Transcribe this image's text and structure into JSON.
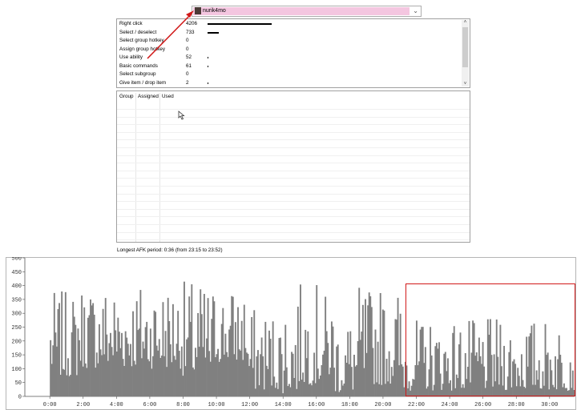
{
  "player": {
    "name": "nurik4mo"
  },
  "actions": [
    {
      "label": "Right click",
      "count": "4206",
      "value": 4206
    },
    {
      "label": "Select / deselect",
      "count": "733",
      "value": 733
    },
    {
      "label": "Select group hotkey",
      "count": "0",
      "value": 0
    },
    {
      "label": "Assign group hotkey",
      "count": "0",
      "value": 0
    },
    {
      "label": "Use ability",
      "count": "52",
      "value": 52
    },
    {
      "label": "Basic commands",
      "count": "61",
      "value": 61
    },
    {
      "label": "Select subgroup",
      "count": "0",
      "value": 0
    },
    {
      "label": "Give item / drop item",
      "count": "2",
      "value": 2
    }
  ],
  "groups_table": {
    "headers": [
      "Group",
      "Assigned",
      "Used"
    ]
  },
  "afk_text": "Longest AFK period: 0:36 (from 23:15 to 23:52)",
  "colors": {
    "bar": "#808080",
    "highlight": "#d11a1a",
    "selection": "#f4c6e0"
  },
  "chart_data": {
    "type": "bar",
    "xlabel": "",
    "ylabel": "",
    "ylim": [
      0,
      500
    ],
    "yticks": [
      0,
      50,
      100,
      150,
      200,
      250,
      300,
      350,
      400,
      450,
      500
    ],
    "xticks": [
      "0:00",
      "2:00",
      "4:00",
      "6:00",
      "8:00",
      "10:00",
      "12:00",
      "14:00",
      "16:00",
      "18:00",
      "20:00",
      "22:00",
      "24:00",
      "26:00",
      "28:00",
      "30:00"
    ],
    "xlim_minutes": [
      -1.5,
      31.5
    ],
    "segments": [
      {
        "start": 0.0,
        "end": 1.6,
        "lo": 70,
        "hi": 380
      },
      {
        "start": 1.6,
        "end": 7.9,
        "lo": 100,
        "hi": 420
      },
      {
        "start": 7.9,
        "end": 9.8,
        "lo": 60,
        "hi": 420
      },
      {
        "start": 9.8,
        "end": 11.8,
        "lo": 120,
        "hi": 400
      },
      {
        "start": 11.8,
        "end": 13.8,
        "lo": 20,
        "hi": 320
      },
      {
        "start": 13.8,
        "end": 14.8,
        "lo": 10,
        "hi": 360
      },
      {
        "start": 14.8,
        "end": 16.2,
        "lo": 40,
        "hi": 410
      },
      {
        "start": 16.2,
        "end": 17.0,
        "lo": 60,
        "hi": 370
      },
      {
        "start": 17.0,
        "end": 18.5,
        "lo": 10,
        "hi": 300
      },
      {
        "start": 18.5,
        "end": 21.0,
        "lo": 40,
        "hi": 400
      },
      {
        "start": 21.0,
        "end": 31.5,
        "lo": 20,
        "hi": 280
      }
    ]
  }
}
